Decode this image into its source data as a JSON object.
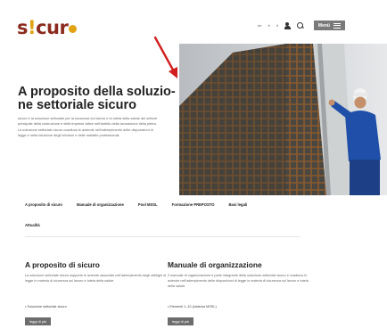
{
  "header": {
    "logo": {
      "s": "s",
      "bang": "!",
      "rest": "cur"
    },
    "lang_links": [
      "de",
      "fr",
      "it"
    ],
    "menu_label": "Menü"
  },
  "hero": {
    "title": "A proposito della soluzio-ne settoriale sicuro",
    "text": "sicuro è la soluzione settoriale per la sicurezza sul lavoro e la tutela della salute del settore principale della costruzione e delle imprese attive nell'ambito della lavorazione della pietra. La soluzione settoriale sicuro coadiuva le aziende nell'adempimento delle disposizioni di legge e nella riduzione degli infortuni e delle malattie professionali."
  },
  "tabs": [
    "A proposito di sicuro",
    "Manuale di organizzazione",
    "Pool MSSL",
    "Formazione PREPOSTO",
    "Basi legali",
    "Attualità"
  ],
  "cards": [
    {
      "title": "A proposito di sicuro",
      "text": "La soluzione settoriale sicuro supporta le aziende associate nell'adempimento degli obblighi di legge in materia di sicurezza sul lavoro e tutela della salute.",
      "bullet": "• Soluzione settoriale sicuro",
      "button": "leggi di più"
    },
    {
      "title": "Manuale di organizzazione",
      "text": "Il manuale di organizzazione è parte integrante della soluzione settoriale sicuro e coadiuva le aziende nell'adempimento delle disposizioni di legge in materia di sicurezza sul lavoro e tutela della salute.",
      "bullet": "• Elementi 1–10 (sistema MSSL)",
      "button": "leggi di più"
    }
  ],
  "colors": {
    "logo_red": "#8b2a1e",
    "logo_yellow": "#e2a313",
    "arrow": "#d11f1f",
    "button_gray": "#6d6d6d"
  }
}
